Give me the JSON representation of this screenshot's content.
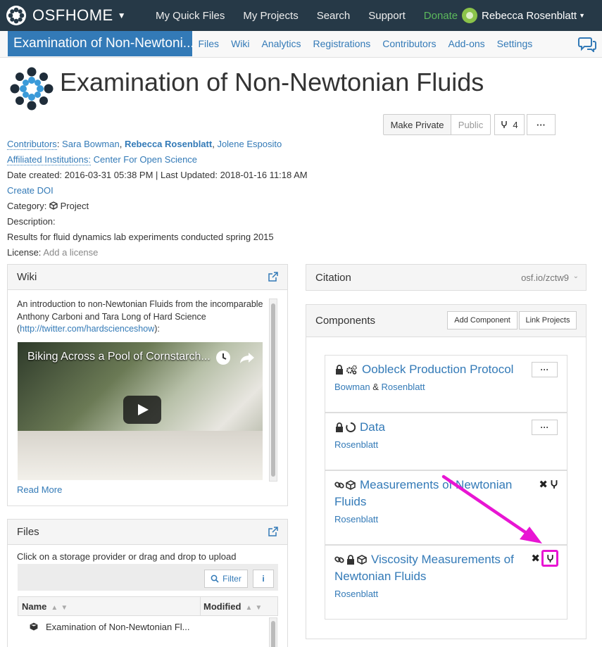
{
  "topnav": {
    "brand": "OSFHOME",
    "links": [
      "My Quick Files",
      "My Projects",
      "Search",
      "Support",
      "Donate"
    ],
    "user_name": "Rebecca Rosenblatt"
  },
  "projnav": {
    "title": "Examination of Non-Newtoni...",
    "links": [
      "Files",
      "Wiki",
      "Analytics",
      "Registrations",
      "Contributors",
      "Add-ons",
      "Settings"
    ]
  },
  "header": {
    "title": "Examination of Non-Newtonian Fluids",
    "make_private_label": "Make Private",
    "public_label": "Public",
    "fork_count": "4",
    "more_label": "···"
  },
  "meta": {
    "contributors_label": "Contributors",
    "contributors": [
      "Sara Bowman",
      "Rebecca Rosenblatt",
      "Jolene Esposito"
    ],
    "affiliated_label": "Affiliated Institutions:",
    "affiliated_value": "Center For Open Science",
    "dates": "Date created: 2016-03-31 05:38 PM | Last Updated: 2018-01-16 11:18 AM",
    "create_doi": "Create DOI",
    "category_label": "Category:",
    "category_value": "Project",
    "description_label": "Description:",
    "description_value": "Results for fluid dynamics lab experiments conducted spring 2015",
    "license_label": "License:",
    "license_value": "Add a license"
  },
  "wiki": {
    "heading": "Wiki",
    "text_before": "An introduction to non-Newtonian Fluids from the incomparable Anthony Carboni and Tara Long of Hard Science (",
    "text_link": "http://twitter.com/hardscienceshow",
    "text_after": "):",
    "video_title": "Biking Across a Pool of Cornstarch...",
    "read_more": "Read More"
  },
  "files": {
    "heading": "Files",
    "hint": "Click on a storage provider or drag and drop to upload",
    "filter_label": "Filter",
    "info_label": "i",
    "col_name": "Name",
    "col_modified": "Modified",
    "row_1": "Examination of Non-Newtonian Fl..."
  },
  "citation": {
    "heading": "Citation",
    "short_link": "osf.io/zctw9"
  },
  "components": {
    "heading": "Components",
    "add_label": "Add Component",
    "link_label": "Link Projects",
    "items": [
      {
        "title": "Oobleck Production Protocol",
        "authors": [
          "Bowman",
          "Rosenblatt"
        ],
        "sep": "&"
      },
      {
        "title": "Data",
        "authors": [
          "Rosenblatt"
        ]
      },
      {
        "title": "Measurements of Newtonian Fluids",
        "authors": [
          "Rosenblatt"
        ]
      },
      {
        "title": "Viscosity Measurements of Newtonian Fluids",
        "authors": [
          "Rosenblatt"
        ]
      }
    ]
  },
  "colors": {
    "navbar": "#263947",
    "link": "#337ab7",
    "donate": "#5cb85c",
    "highlight": "#e815d3"
  }
}
